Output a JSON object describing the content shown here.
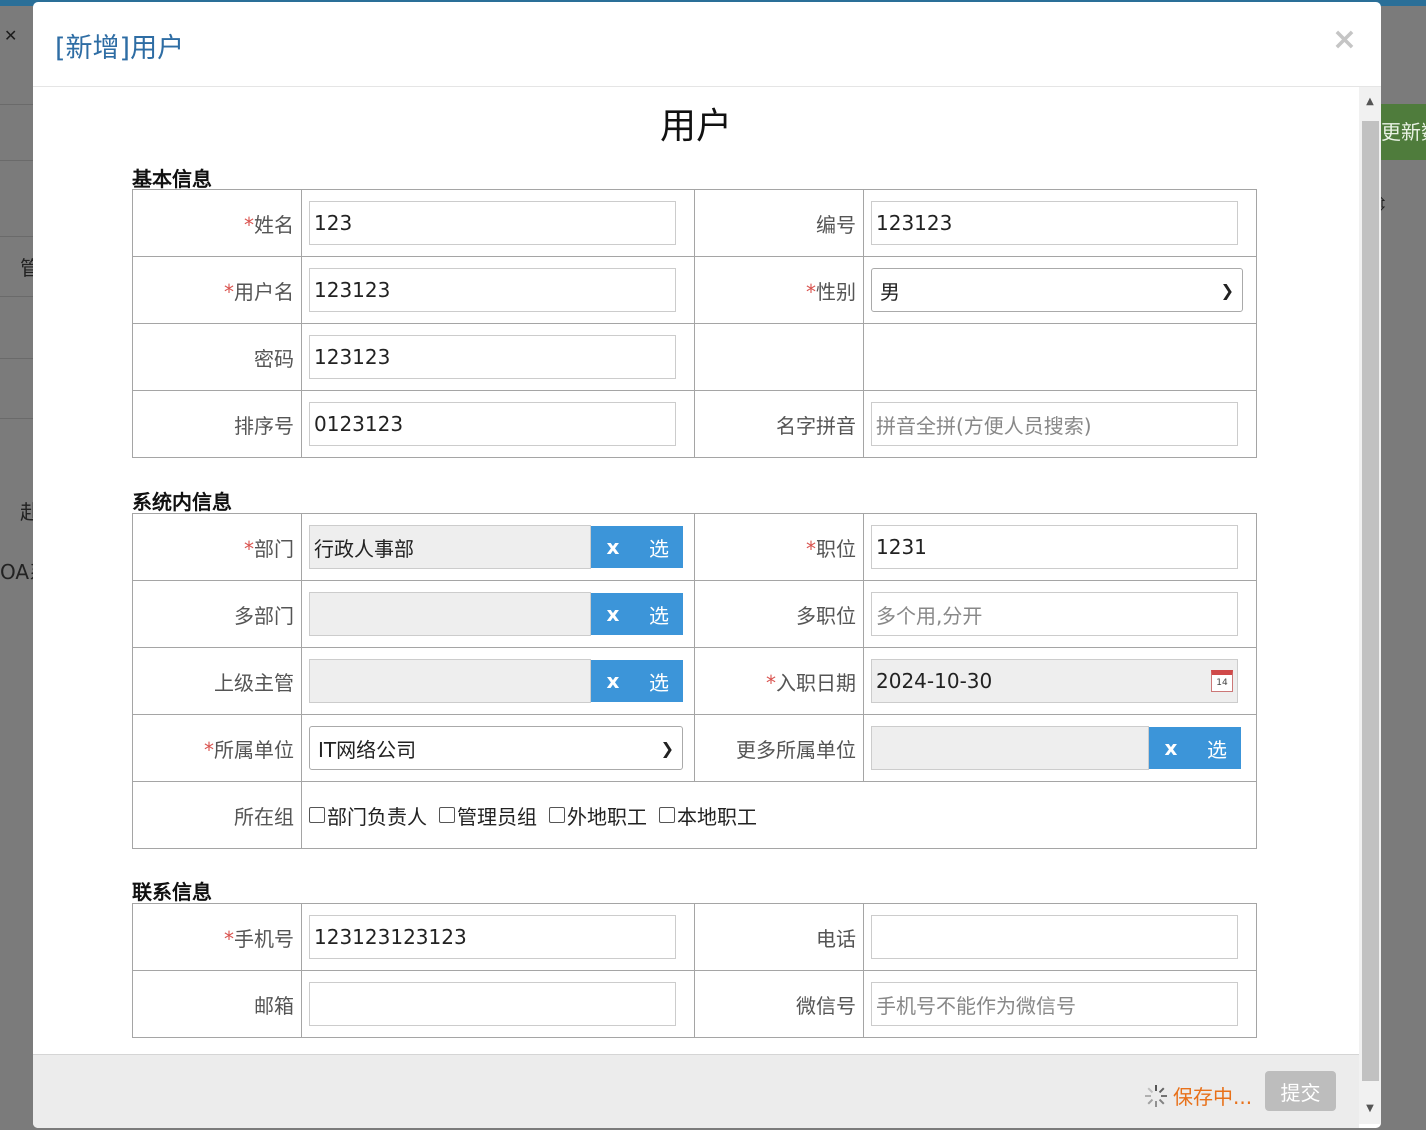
{
  "background": {
    "fragments": [
      "管",
      "赴",
      "OA系",
      "更新数"
    ]
  },
  "modal": {
    "title": "[新增]用户",
    "close_glyph": "×",
    "form_title": "用户"
  },
  "sections": {
    "basic": "基本信息",
    "system": "系统内信息",
    "contact": "联系信息"
  },
  "basic": {
    "name_label": "姓名",
    "name_value": "123",
    "number_label": "编号",
    "number_value": "123123",
    "username_label": "用户名",
    "username_value": "123123",
    "gender_label": "性别",
    "gender_value": "男",
    "password_label": "密码",
    "password_value": "123123",
    "sort_label": "排序号",
    "sort_value": "0123123",
    "pinyin_label": "名字拼音",
    "pinyin_placeholder": "拼音全拼(方便人员搜索)"
  },
  "system": {
    "dept_label": "部门",
    "dept_value": "行政人事部",
    "position_label": "职位",
    "position_value": "1231",
    "multi_dept_label": "多部门",
    "multi_dept_value": "",
    "multi_position_label": "多职位",
    "multi_position_placeholder": "多个用,分开",
    "supervisor_label": "上级主管",
    "supervisor_value": "",
    "entry_date_label": "入职日期",
    "entry_date_value": "2024-10-30",
    "company_label": "所属单位",
    "company_value": "IT网络公司",
    "more_company_label": "更多所属单位",
    "more_company_value": "",
    "group_label": "所在组",
    "groups": [
      "部门负责人",
      "管理员组",
      "外地职工",
      "本地职工"
    ],
    "btn_clear": "x",
    "btn_select": "选",
    "required_mark": "*"
  },
  "contact": {
    "mobile_label": "手机号",
    "mobile_value": "123123123123",
    "phone_label": "电话",
    "phone_value": "",
    "email_label": "邮箱",
    "email_value": "",
    "wechat_label": "微信号",
    "wechat_placeholder": "手机号不能作为微信号"
  },
  "footer": {
    "saving_text": "保存中...",
    "submit_label": "提交"
  },
  "colors": {
    "accent_blue": "#3c95d9",
    "title_blue": "#2e6da4",
    "required_red": "#d9534f",
    "saving_orange": "#e8711a"
  }
}
